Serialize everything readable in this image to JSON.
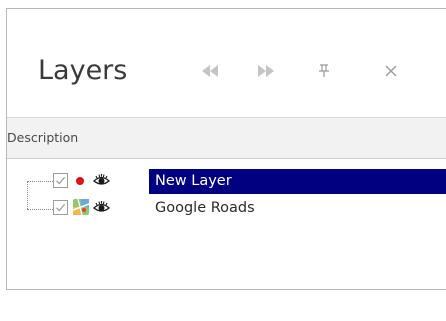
{
  "panel": {
    "title": "Layers",
    "column_header": "Description"
  },
  "header_buttons": [
    {
      "name": "first-icon"
    },
    {
      "name": "last-icon"
    },
    {
      "name": "pin-icon"
    },
    {
      "name": "close-icon"
    }
  ],
  "layers": [
    {
      "label": "New Layer",
      "checked": true,
      "icon": "red-dot-icon",
      "visible_icon": "eye-icon",
      "selected": true
    },
    {
      "label": "Google Roads",
      "checked": true,
      "icon": "map-tile-icon",
      "visible_icon": "eye-icon",
      "selected": false
    }
  ],
  "colors": {
    "selection": "#000080",
    "layer_dot": "#e0101b",
    "icon_gray": "#a0a0a0"
  }
}
